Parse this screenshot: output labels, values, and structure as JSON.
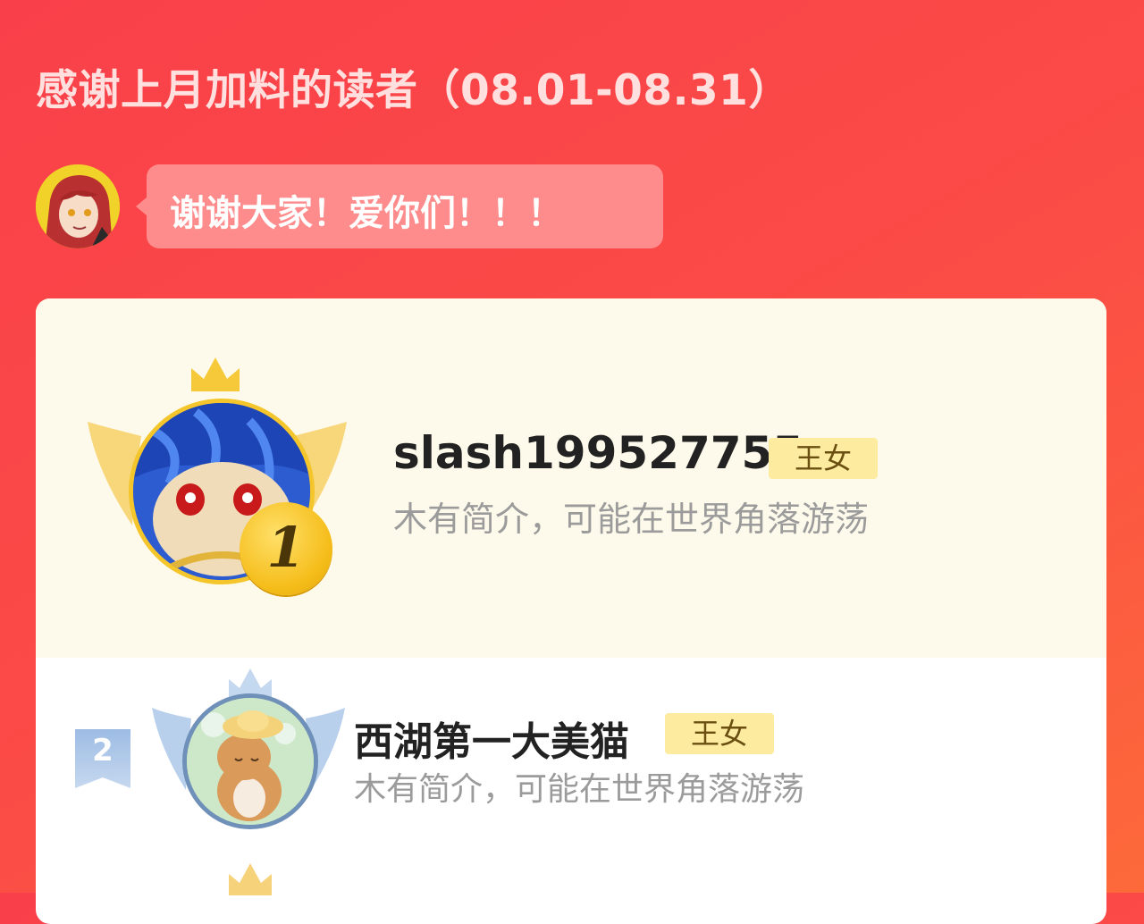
{
  "header": {
    "title": "感谢上月加料的读者（08.01-08.31）"
  },
  "author_message": {
    "text": "谢谢大家！爱你们！！！"
  },
  "ranking": [
    {
      "rank": "1",
      "name": "slash199527755",
      "tag": "王女",
      "bio": "木有简介，可能在世界角落游荡"
    },
    {
      "rank": "2",
      "name": "西湖第一大美猫",
      "tag": "王女",
      "bio": "木有简介，可能在世界角落游荡"
    }
  ],
  "colors": {
    "background_start": "#f9404a",
    "background_end": "#fd6a3a",
    "title": "#ffe0df",
    "bubble": "#ff8c8c",
    "first_row_bg": "#fefaeb",
    "gold": "#f4c62c",
    "tag_bg": "#fdeba0",
    "silver_blue": "#6f90b8"
  },
  "icons": {
    "first_crown": "gold-crown-icon",
    "first_wings": "gold-wings-icon",
    "first_medal": "gold-medal-icon",
    "second_flag": "rank-flag-icon",
    "second_crown": "silver-crown-icon",
    "second_wings": "silver-wings-icon"
  }
}
